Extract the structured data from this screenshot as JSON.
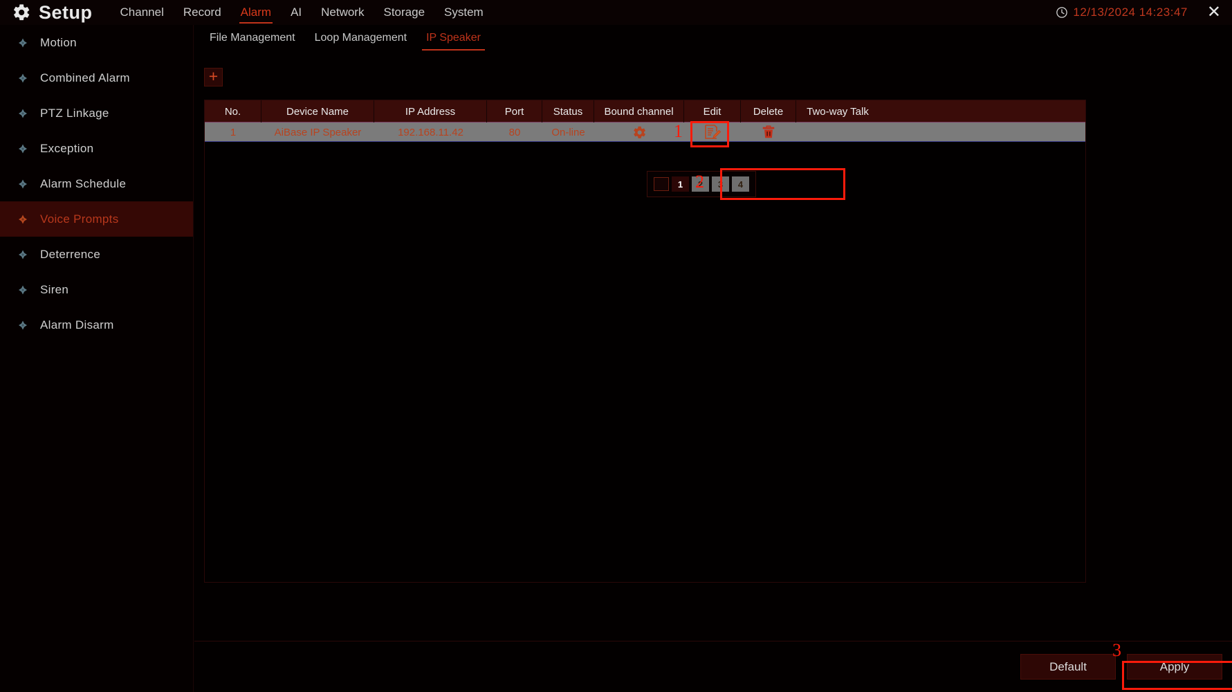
{
  "topbar": {
    "logo_icon": "gear-icon",
    "title": "Setup",
    "nav": [
      {
        "label": "Channel",
        "active": false
      },
      {
        "label": "Record",
        "active": false
      },
      {
        "label": "Alarm",
        "active": true
      },
      {
        "label": "AI",
        "active": false
      },
      {
        "label": "Network",
        "active": false
      },
      {
        "label": "Storage",
        "active": false
      },
      {
        "label": "System",
        "active": false
      }
    ],
    "clock_icon": "clock-icon",
    "datetime": "12/13/2024 14:23:47",
    "close_icon": "close-icon",
    "close_glyph": "✕"
  },
  "sidebar": {
    "items": [
      {
        "label": "Motion",
        "icon": "diamond-icon",
        "active": false
      },
      {
        "label": "Combined Alarm",
        "icon": "diamond-icon",
        "active": false
      },
      {
        "label": "PTZ Linkage",
        "icon": "diamond-icon",
        "active": false
      },
      {
        "label": "Exception",
        "icon": "diamond-icon",
        "active": false
      },
      {
        "label": "Alarm Schedule",
        "icon": "diamond-icon",
        "active": false
      },
      {
        "label": "Voice Prompts",
        "icon": "diamond-icon",
        "active": true
      },
      {
        "label": "Deterrence",
        "icon": "diamond-icon",
        "active": false
      },
      {
        "label": "Siren",
        "icon": "diamond-icon",
        "active": false
      },
      {
        "label": "Alarm Disarm",
        "icon": "diamond-icon",
        "active": false
      }
    ]
  },
  "subtabs": [
    {
      "label": "File Management",
      "active": false
    },
    {
      "label": "Loop Management",
      "active": false
    },
    {
      "label": "IP Speaker",
      "active": true
    }
  ],
  "toolbar": {
    "add_label": "+",
    "add_icon": "plus-icon"
  },
  "table": {
    "columns": [
      "No.",
      "Device Name",
      "IP Address",
      "Port",
      "Status",
      "Bound channel",
      "Edit",
      "Delete",
      "Two-way Talk"
    ],
    "rows": [
      {
        "no": "1",
        "device_name": "AiBase IP Speaker",
        "ip_address": "192.168.11.42",
        "port": "80",
        "status": "On-line",
        "bound_channel_icon": "gear-icon",
        "edit_icon": "edit-document-icon",
        "delete_icon": "trash-icon",
        "two_way_talk": ""
      }
    ]
  },
  "channel_popup": {
    "select_all_checked": false,
    "channels": [
      {
        "label": "1",
        "selected": true
      },
      {
        "label": "2",
        "selected": false
      },
      {
        "label": "3",
        "selected": false
      },
      {
        "label": "4",
        "selected": false
      }
    ]
  },
  "annotations": [
    {
      "number": "1"
    },
    {
      "number": "2"
    },
    {
      "number": "3"
    }
  ],
  "footer": {
    "default_label": "Default",
    "apply_label": "Apply"
  },
  "colors": {
    "accent_red": "#c0331a",
    "annotation_red": "#fb1b0b",
    "header_maroon": "#3a0c09",
    "row_gray": "#7b7b7b"
  }
}
